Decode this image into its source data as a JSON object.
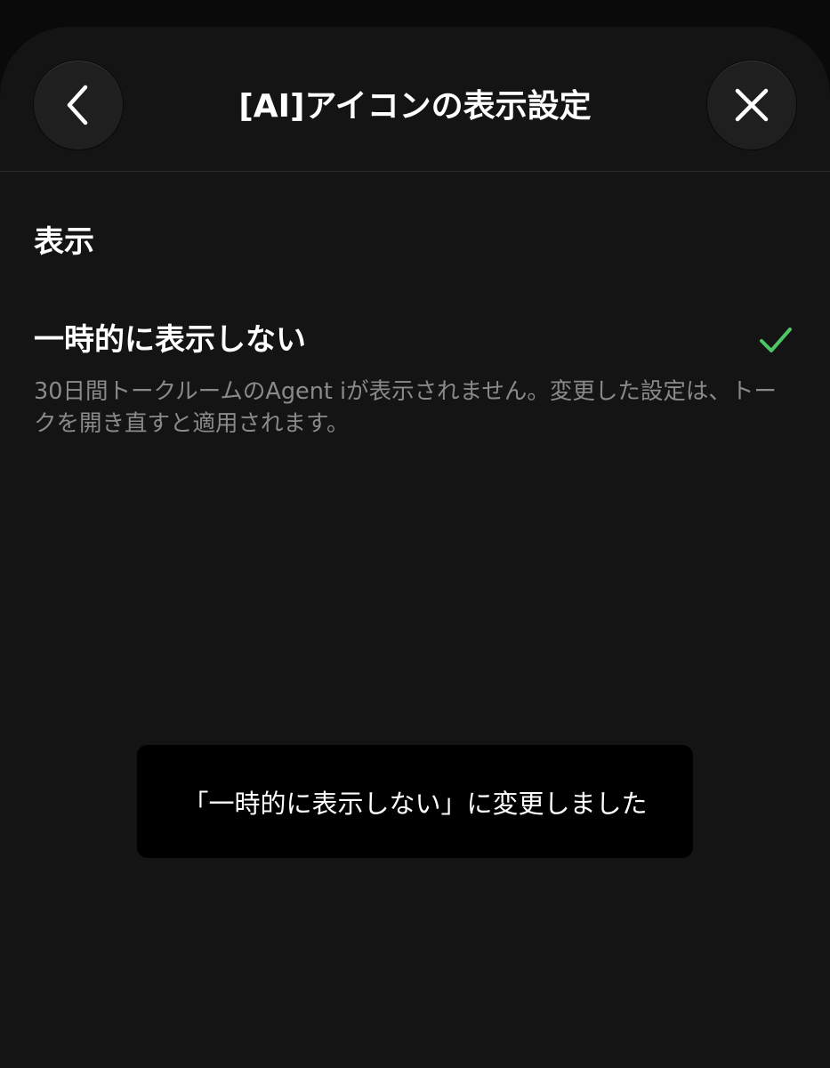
{
  "header": {
    "title": "[AI]アイコンの表示設定",
    "back_icon": "chevron-left-icon",
    "close_icon": "close-icon"
  },
  "section": {
    "label": "表示"
  },
  "option": {
    "title": "一時的に表示しない",
    "description": "30日間トークルームのAgent iが表示されません。変更した設定は、トークを開き直すと適用されます。",
    "selected": true,
    "check_icon": "checkmark-icon",
    "check_color": "#4cc764"
  },
  "toast": {
    "message": "「一時的に表示しない」に変更しました"
  },
  "colors": {
    "background": "#0a0a0a",
    "sheet": "#141414",
    "button": "#1f1f1f",
    "text_primary": "#ffffff",
    "text_secondary": "#8a8a8a",
    "toast_bg": "#000000"
  }
}
